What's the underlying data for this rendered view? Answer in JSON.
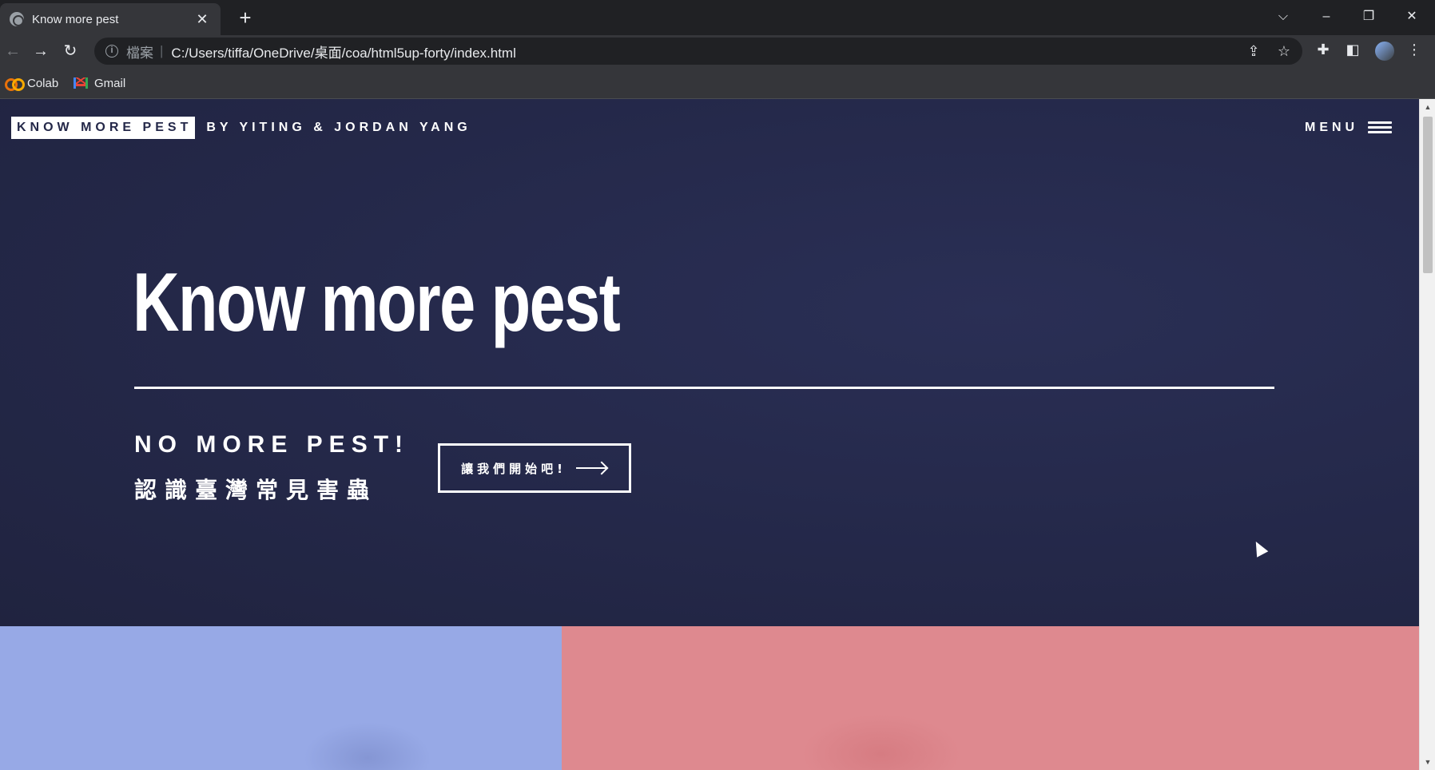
{
  "browser": {
    "tab": {
      "title": "Know more pest",
      "close_glyph": "✕"
    },
    "new_tab_glyph": "+",
    "window_controls": {
      "tabsearch": "⌵",
      "minimize": "–",
      "restore": "❐",
      "close": "✕"
    },
    "nav": {
      "back": "←",
      "forward": "→",
      "reload": "↻"
    },
    "address": {
      "scheme_label": "檔案",
      "separator": "|",
      "url": "C:/Users/tiffa/OneDrive/桌面/coa/html5up-forty/index.html"
    },
    "icons": {
      "share": "⇪",
      "bookmark": "☆",
      "extensions": "✚",
      "sidepanel": "◧",
      "more": "⋮"
    },
    "bookmarks": [
      {
        "label": "Colab"
      },
      {
        "label": "Gmail"
      }
    ]
  },
  "page": {
    "logo_box": "KNOW MORE PEST",
    "logo_rest": "BY YITING & JORDAN YANG",
    "menu_label": "MENU",
    "title": "Know more pest",
    "subtitle_en": "NO MORE PEST!",
    "subtitle_zh": "認識臺灣常見害蟲",
    "cta_label": "讓我們開始吧!",
    "colors": {
      "hero_bg": "#242849",
      "tile_blue": "#97a9e6",
      "tile_pink": "#de898f"
    }
  },
  "scrollbar": {
    "up": "▲",
    "down": "▼"
  }
}
